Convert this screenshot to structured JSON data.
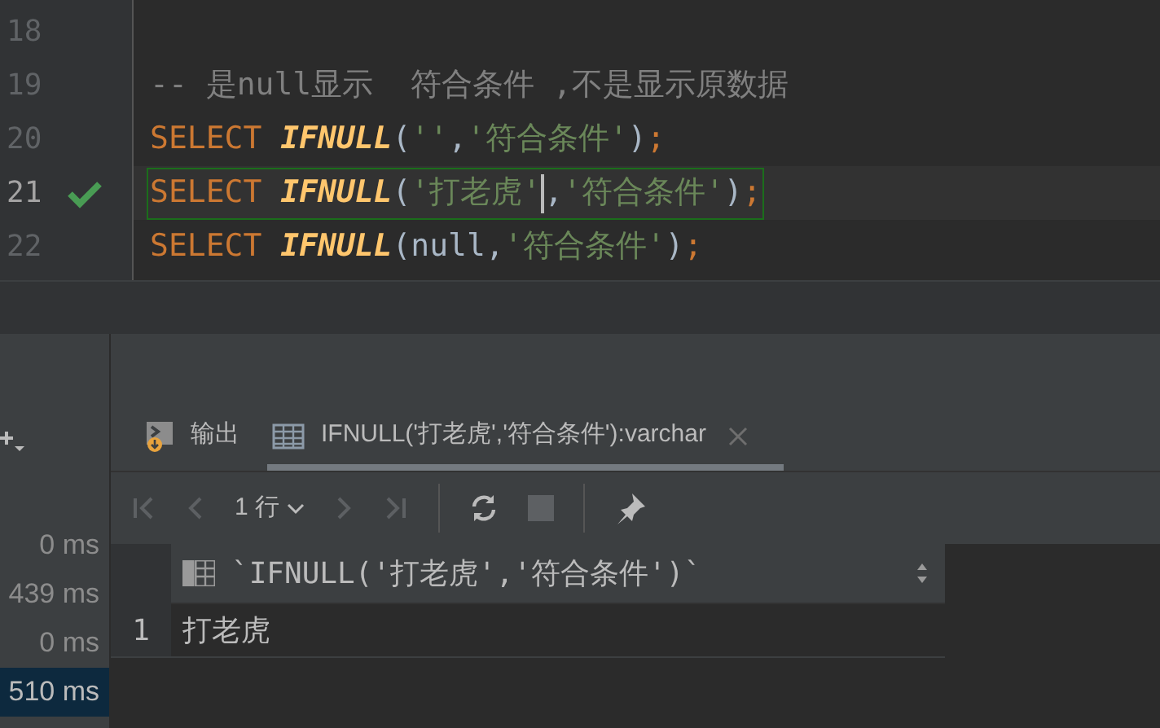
{
  "editor": {
    "lines": [
      {
        "number": "18"
      },
      {
        "number": "19",
        "tokens": [
          {
            "kind": "comment",
            "text": "-- 是null显示  符合条件 ,不是显示原数据"
          }
        ]
      },
      {
        "number": "20",
        "tokens": [
          {
            "kind": "keyword",
            "text": "SELECT "
          },
          {
            "kind": "function",
            "text": "IFNULL"
          },
          {
            "kind": "punct",
            "text": "("
          },
          {
            "kind": "string",
            "text": "''"
          },
          {
            "kind": "punct",
            "text": ","
          },
          {
            "kind": "string",
            "text": "'符合条件'"
          },
          {
            "kind": "punct",
            "text": ")"
          },
          {
            "kind": "keyword",
            "text": ";"
          }
        ]
      },
      {
        "number": "21",
        "current": true,
        "executed": true,
        "tokens": [
          {
            "kind": "keyword",
            "text": "SELECT "
          },
          {
            "kind": "function",
            "text": "IFNULL"
          },
          {
            "kind": "punct",
            "text": "("
          },
          {
            "kind": "string",
            "text": "'打老虎'"
          },
          {
            "kind": "caret"
          },
          {
            "kind": "punct",
            "text": ","
          },
          {
            "kind": "string",
            "text": "'符合条件'"
          },
          {
            "kind": "punct",
            "text": ")"
          },
          {
            "kind": "keyword",
            "text": ";"
          }
        ]
      },
      {
        "number": "22",
        "tokens": [
          {
            "kind": "keyword",
            "text": "SELECT "
          },
          {
            "kind": "function",
            "text": "IFNULL"
          },
          {
            "kind": "punct",
            "text": "("
          },
          {
            "kind": "null",
            "text": "null"
          },
          {
            "kind": "punct",
            "text": ","
          },
          {
            "kind": "string",
            "text": "'符合条件'"
          },
          {
            "kind": "punct",
            "text": ")"
          },
          {
            "kind": "keyword",
            "text": ";"
          }
        ]
      }
    ]
  },
  "history": [
    {
      "time": "0 ms",
      "selected": false
    },
    {
      "time": "439 ms",
      "selected": false
    },
    {
      "time": "0 ms",
      "selected": false
    },
    {
      "time": "510 ms",
      "selected": true
    }
  ],
  "tabs": [
    {
      "kind": "output",
      "label": "输出",
      "selected": false
    },
    {
      "kind": "table",
      "label": "IFNULL('打老虎','符合条件'):varchar",
      "selected": true
    }
  ],
  "toolbar": {
    "page_size": "1 行"
  },
  "grid": {
    "columns": [
      "`IFNULL('打老虎','符合条件')`"
    ],
    "rows": [
      {
        "number": "1",
        "cells": [
          "打老虎"
        ]
      }
    ]
  }
}
